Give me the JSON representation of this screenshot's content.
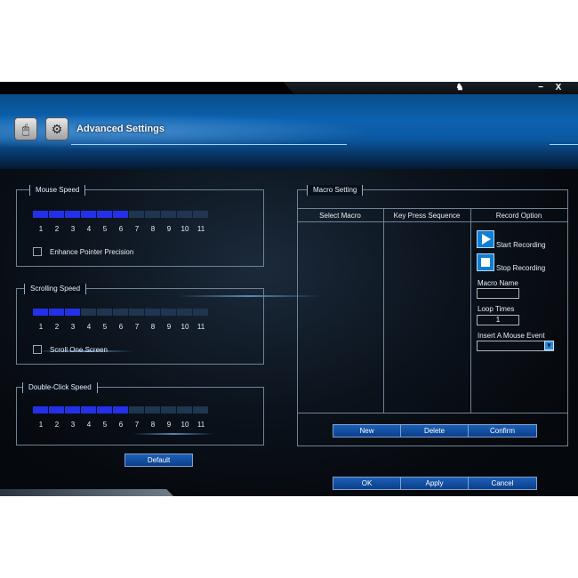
{
  "window": {
    "controls": {
      "minimize": "−",
      "close": "X"
    },
    "header": {
      "title": "Advanced Settings"
    }
  },
  "mouse_speed": {
    "title": "Mouse Speed",
    "level": 6,
    "ticks": [
      "1",
      "2",
      "3",
      "4",
      "5",
      "6",
      "7",
      "8",
      "9",
      "10",
      "11"
    ],
    "checkbox_label": "Enhance Pointer Precision",
    "checked": false
  },
  "scrolling_speed": {
    "title": "Scrolling Speed",
    "level": 3,
    "ticks": [
      "1",
      "2",
      "3",
      "4",
      "5",
      "6",
      "7",
      "8",
      "9",
      "10",
      "11"
    ],
    "checkbox_label": "Scroll One Screen",
    "checked": false
  },
  "double_click_speed": {
    "title": "Double-Click Speed",
    "level": 6,
    "ticks": [
      "1",
      "2",
      "3",
      "4",
      "5",
      "6",
      "7",
      "8",
      "9",
      "10",
      "11"
    ]
  },
  "default_button": "Default",
  "macro": {
    "title": "Macro Setting",
    "columns": [
      "Select Macro",
      "Key Press Sequence",
      "Record Option"
    ],
    "start_recording": "Start Recording",
    "stop_recording": "Stop Recording",
    "macro_name_label": "Macro Name",
    "macro_name_value": "",
    "loop_times_label": "Loop Times",
    "loop_times_value": "1",
    "insert_event_label": "Insert A Mouse Event",
    "insert_event_value": "",
    "buttons": {
      "new": "New",
      "delete": "Delete",
      "confirm": "Confirm"
    }
  },
  "footer": {
    "ok": "OK",
    "apply": "Apply",
    "cancel": "Cancel"
  },
  "colors": {
    "segment_on": "#2430e8",
    "segment_off": "#203550",
    "accent": "#0c62b0"
  }
}
